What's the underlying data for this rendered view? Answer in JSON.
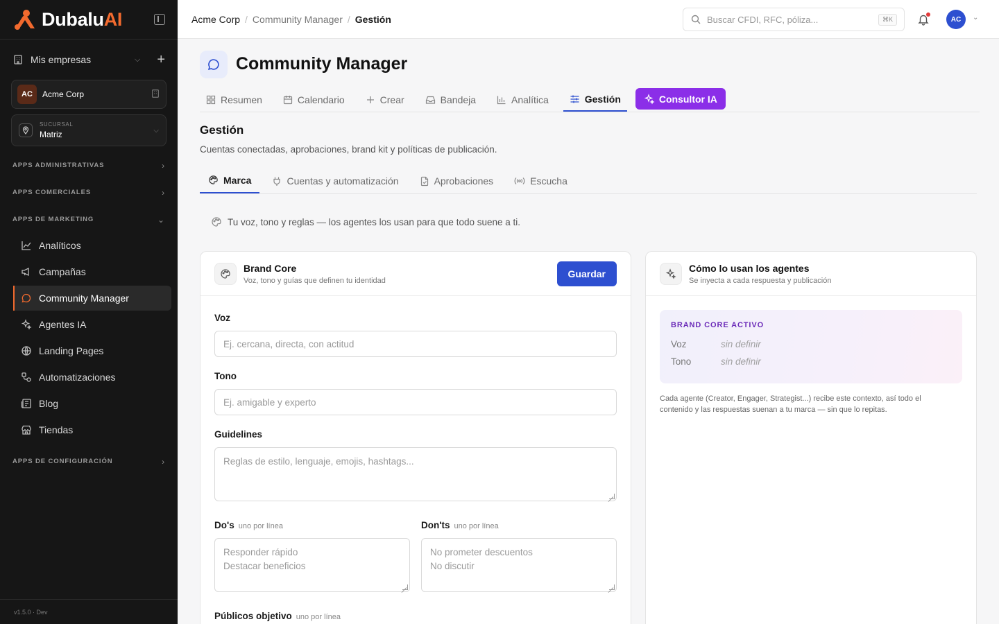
{
  "app": {
    "logo_main": "Dubalu",
    "logo_ai": "AI",
    "version": "v1.5.0 · Dev"
  },
  "sidebar": {
    "companies_label": "Mis empresas",
    "company": {
      "initials": "AC",
      "name": "Acme Corp"
    },
    "branch": {
      "caption": "SUCURSAL",
      "value": "Matriz"
    },
    "sections": {
      "admin": "APPS ADMINISTRATIVAS",
      "commercial": "APPS COMERCIALES",
      "marketing": "APPS DE MARKETING",
      "config": "APPS DE CONFIGURACIÓN"
    },
    "items": [
      {
        "label": "Analíticos",
        "icon": "chart-line-icon"
      },
      {
        "label": "Campañas",
        "icon": "megaphone-icon"
      },
      {
        "label": "Community Manager",
        "icon": "chat-bubble-icon",
        "active": true
      },
      {
        "label": "Agentes IA",
        "icon": "sparkles-icon"
      },
      {
        "label": "Landing Pages",
        "icon": "globe-icon"
      },
      {
        "label": "Automatizaciones",
        "icon": "workflow-icon"
      },
      {
        "label": "Blog",
        "icon": "newspaper-icon"
      },
      {
        "label": "Tiendas",
        "icon": "store-icon"
      }
    ]
  },
  "topbar": {
    "breadcrumb": [
      "Acme Corp",
      "Community Manager",
      "Gestión"
    ],
    "search_placeholder": "Buscar CFDI, RFC, póliza...",
    "search_shortcut": "⌘K",
    "avatar_initials": "AC"
  },
  "page": {
    "title": "Community Manager",
    "tabs": [
      "Resumen",
      "Calendario",
      "Crear",
      "Bandeja",
      "Analítica",
      "Gestión"
    ],
    "active_tab": "Gestión",
    "ai_tab": "Consultor IA",
    "section_title": "Gestión",
    "section_subtitle": "Cuentas conectadas, aprobaciones, brand kit y políticas de publicación.",
    "subtabs": [
      "Marca",
      "Cuentas y automatización",
      "Aprobaciones",
      "Escucha"
    ],
    "active_subtab": "Marca",
    "hint": "Tu voz, tono y reglas — los agentes los usan para que todo suene a ti."
  },
  "brand_core": {
    "title": "Brand Core",
    "subtitle": "Voz, tono y guías que definen tu identidad",
    "save_label": "Guardar",
    "voz_label": "Voz",
    "voz_placeholder": "Ej. cercana, directa, con actitud",
    "tono_label": "Tono",
    "tono_placeholder": "Ej. amigable y experto",
    "guidelines_label": "Guidelines",
    "guidelines_placeholder": "Reglas de estilo, lenguaje, emojis, hashtags...",
    "dos_label": "Do's",
    "per_line_hint": "uno por línea",
    "dos_placeholder_1": "Responder rápido",
    "dos_placeholder_2": "Destacar beneficios",
    "donts_label": "Don'ts",
    "donts_placeholder_1": "No prometer descuentos",
    "donts_placeholder_2": "No discutir",
    "audiences_label": "Públicos objetivo"
  },
  "agents_card": {
    "title": "Cómo lo usan los agentes",
    "subtitle": "Se inyecta a cada respuesta y publicación",
    "active_title": "BRAND CORE ACTIVO",
    "voz_key": "Voz",
    "voz_value": "sin definir",
    "tono_key": "Tono",
    "tono_value": "sin definir",
    "explanation": "Cada agente (Creator, Engager, Strategist...) recibe este contexto, así todo el contenido y las respuestas suenan a tu marca — sin que lo repitas."
  },
  "colors": {
    "accent": "#2d4fd0",
    "brand": "#f26a2e",
    "ai": "#8b2ee8",
    "sidebar_bg": "#161616"
  }
}
